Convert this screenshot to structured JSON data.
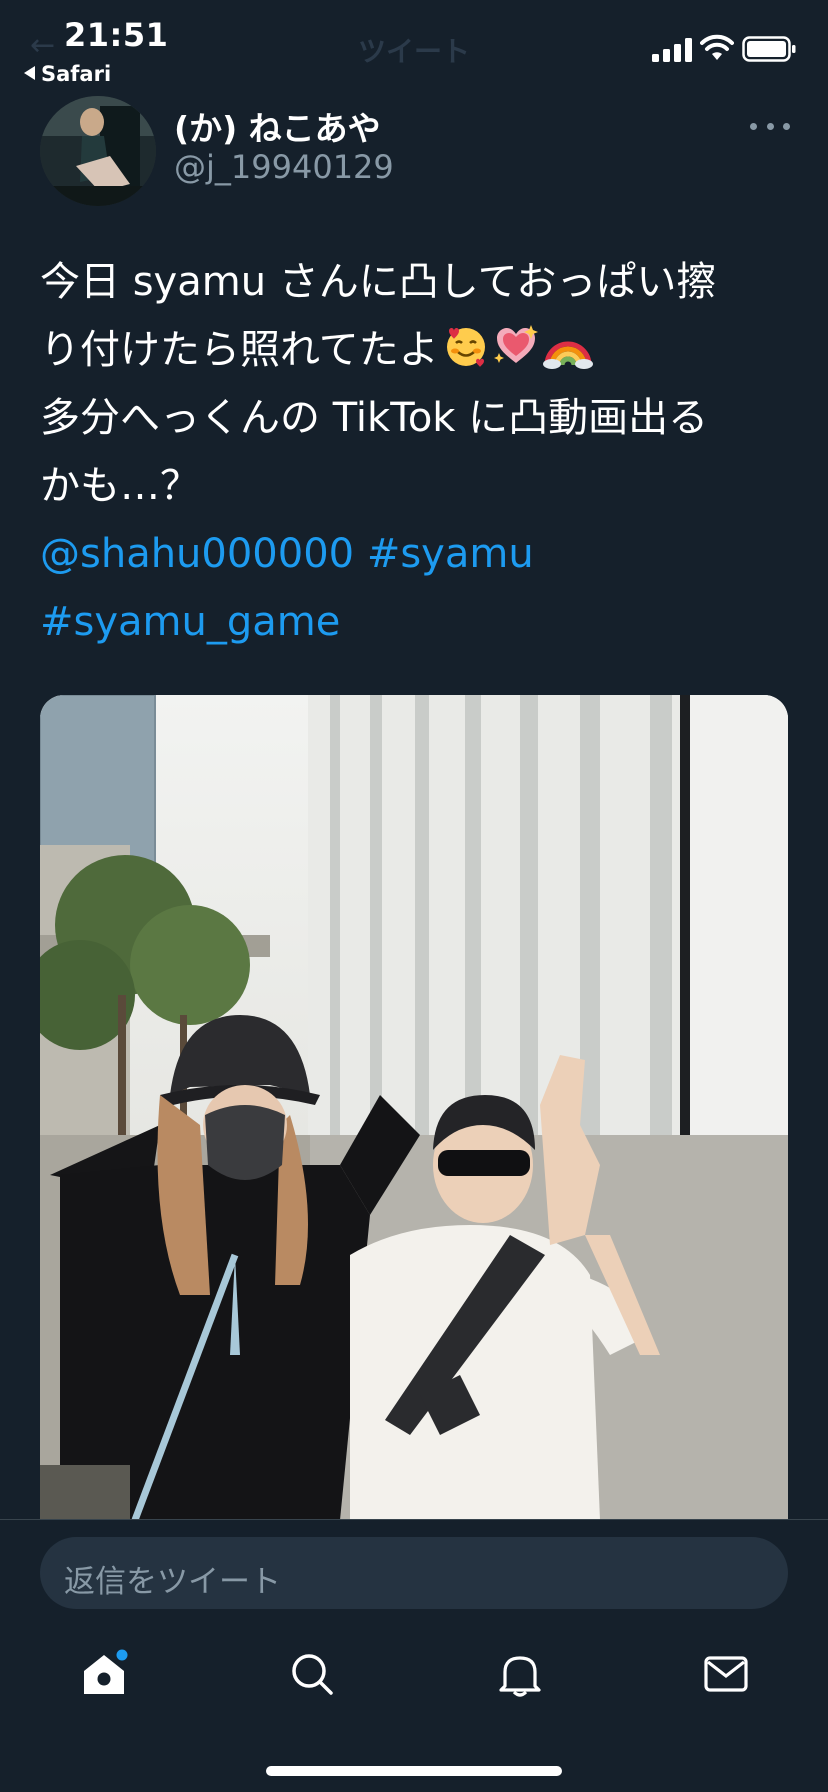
{
  "status_bar": {
    "time": "21:51",
    "back_app": "Safari",
    "screen_title": "ツイート"
  },
  "tweet": {
    "display_name": "(か) ねこあや",
    "handle": "@j_19940129",
    "text_lines": [
      "今日 syamu さんに凸しておっぱい擦",
      "り付けたら照れてたよ",
      "多分へっくんの TikTok に凸動画出る",
      "かも…？"
    ],
    "emojis": [
      "smiling-face-with-hearts",
      "sparkling-heart",
      "rainbow"
    ],
    "mention": "@shahu000000",
    "hashtag_1": "#syamu",
    "hashtag_2": "#syamu_game"
  },
  "reply": {
    "placeholder": "返信をツイート"
  },
  "tab_bar": {
    "icons": [
      "home-icon",
      "search-icon",
      "notifications-icon",
      "messages-icon"
    ],
    "home_has_badge": true
  },
  "colors": {
    "background": "#15202b",
    "accent": "#1d9bf0",
    "secondary_text": "#8899a6",
    "input_background": "#253341"
  }
}
